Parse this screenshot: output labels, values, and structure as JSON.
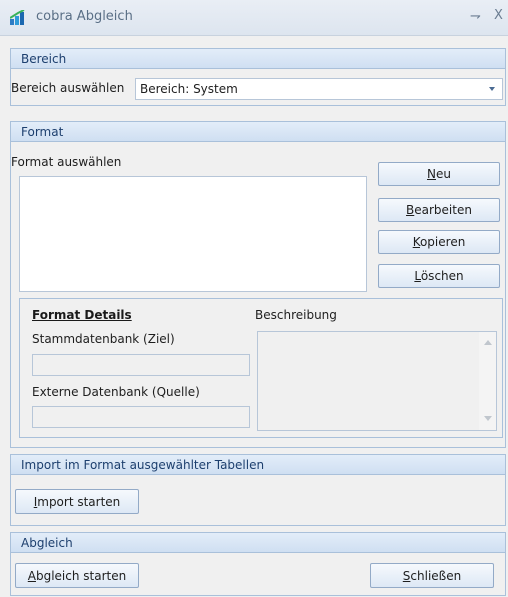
{
  "window": {
    "title": "cobra Abgleich",
    "pin_glyph": "⇁",
    "close_glyph": "X",
    "app_icon": "cobra-app-icon"
  },
  "bereich": {
    "header": "Bereich",
    "select_label": "Bereich auswählen",
    "selected_value": "Bereich: System"
  },
  "format": {
    "header": "Format",
    "list_label": "Format auswählen",
    "items": [],
    "buttons": {
      "neu": {
        "mnemonic": "N",
        "rest": "eu"
      },
      "bearbeiten": {
        "mnemonic": "B",
        "rest": "earbeiten"
      },
      "kopieren": {
        "mnemonic": "K",
        "rest": "opieren"
      },
      "loeschen": {
        "mnemonic": "L",
        "rest": "öschen"
      }
    },
    "details": {
      "title": "Format Details",
      "stammdatenbank_label": "Stammdatenbank (Ziel)",
      "stammdatenbank_value": "",
      "extern_label": "Externe Datenbank (Quelle)",
      "extern_value": "",
      "beschreibung_label": "Beschreibung",
      "beschreibung_value": ""
    }
  },
  "import": {
    "header": "Import im Format ausgewählter Tabellen",
    "button": {
      "mnemonic": "I",
      "rest": "mport starten"
    }
  },
  "abgleich": {
    "header": "Abgleich",
    "start_button": {
      "mnemonic": "A",
      "rest": "bgleich starten"
    },
    "close_button": {
      "pre": "",
      "mnemonic": "S",
      "rest": "chließen"
    }
  },
  "colors": {
    "header_text": "#1d3f6e",
    "panel_border": "#a9c0da",
    "title_text": "#5a6f86"
  }
}
